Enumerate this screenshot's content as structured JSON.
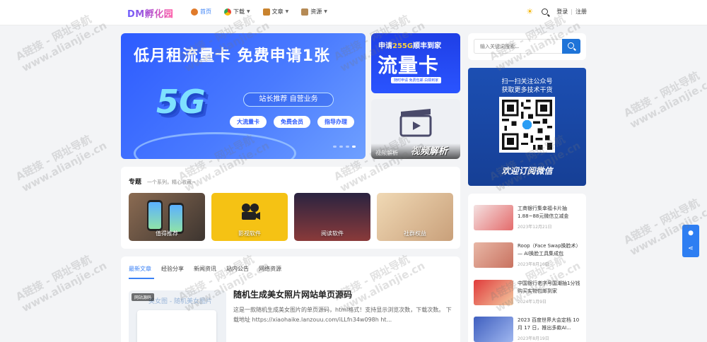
{
  "header": {
    "logo": "DM孵化园",
    "nav": [
      {
        "label": "首页",
        "icon": "home-icon",
        "active": true,
        "dropdown": false
      },
      {
        "label": "下载",
        "icon": "browser-icon",
        "active": false,
        "dropdown": true
      },
      {
        "label": "文章",
        "icon": "megaphone-icon",
        "active": false,
        "dropdown": true
      },
      {
        "label": "资源",
        "icon": "box-icon",
        "active": false,
        "dropdown": true
      }
    ],
    "login": "登录",
    "divider": "|",
    "register": "注册"
  },
  "hero": {
    "title": "低月租流量卡 免费申请1张",
    "badge": "5G",
    "pill": "站长推荐 自营业务",
    "buttons": [
      "大流量卡",
      "免费会员",
      "指导办理"
    ]
  },
  "ad1": {
    "sub_prefix": "申请",
    "sub_highlight": "255G",
    "sub_suffix": "顺丰到家",
    "main": "流量卡",
    "foot": "随时申请 免费包邮 白嫖到家"
  },
  "ad2": {
    "label": "视频解析",
    "big": "视频解析"
  },
  "topics": {
    "title": "专题",
    "subtitle": "一个系列，精心收藏~",
    "cards": [
      {
        "label": "值得推荐"
      },
      {
        "label": "影视软件"
      },
      {
        "label": "阅读软件"
      },
      {
        "label": "社群权益"
      }
    ]
  },
  "posts": {
    "tabs": [
      "最新文章",
      "经验分享",
      "新闻资讯",
      "站内公告",
      "网络资源"
    ],
    "active_tab": 0,
    "item": {
      "tag": "网站源码",
      "thumb_title": "美女图 - 随机美女图片",
      "title": "随机生成美女照片网站单页源码",
      "desc": "这是一款随机生成美女图片的单页源码，html格式！支持显示浏览次数，下载次数。 下载地址 https://xiaohaike.lanzouu.com/iLLfn34w098h ht..."
    }
  },
  "sidebar": {
    "search_placeholder": "输入关键词搜索...",
    "wechat": {
      "line1": "扫一扫关注公众号",
      "line2": "获取更多技术干货",
      "bottom": "欢迎订阅微信"
    },
    "news": [
      {
        "title": "工商银行集幸福卡片抽1.88~88元微信立减金",
        "date": "2023年12月21日",
        "color": "#f2d6d6"
      },
      {
        "title": "Roop（Face Swap换脸术）— AI换脸工具集成包",
        "date": "2023年8月16日",
        "color": "#e6b9a8"
      },
      {
        "title": "中国银行老字号国潮抽1分钱购买实物包邮到家",
        "date": "2024年1月9日",
        "color": "#d93a3a"
      },
      {
        "title": "2023 百度世界大会定档 10 月 17 日，推出多款AI...",
        "date": "2023年8月19日",
        "color": "#4f6fc4"
      }
    ]
  },
  "watermark": {
    "line1": "A链接 - 网址导航",
    "line2": "www.alianjie.cn"
  },
  "colors": {
    "accent": "#3b82f6",
    "hero_blue": "#2d5bff",
    "wechat_blue": "#1c4fb3"
  }
}
